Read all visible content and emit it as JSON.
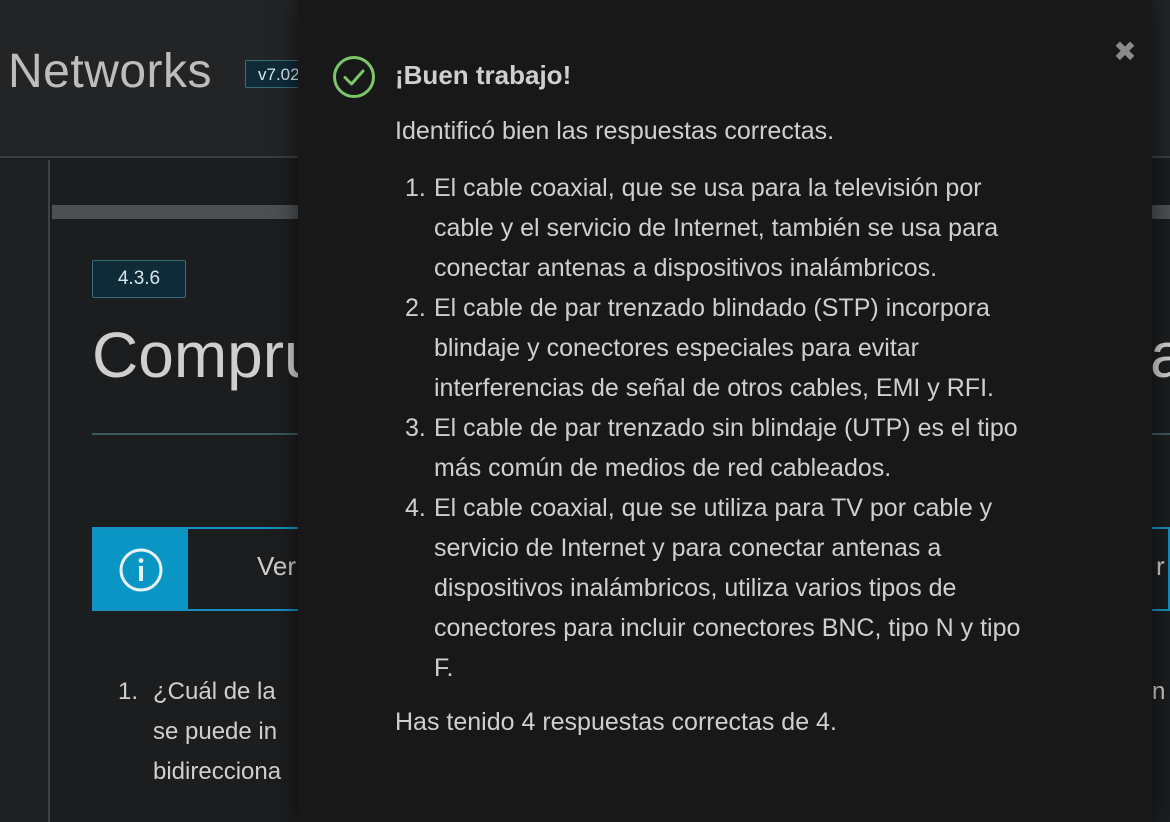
{
  "app": {
    "brand": "Networks",
    "version": "v7.02"
  },
  "page": {
    "section_number": "4.3.6",
    "heading_visible": "Compru",
    "heading_tail": "a",
    "info_bar_text": "Ver",
    "info_bar_tail": "r",
    "question": {
      "number": "1.",
      "lines": [
        "¿Cuál de la",
        "se puede in",
        "bidirecciona"
      ],
      "tail": "n"
    }
  },
  "modal": {
    "close_label": "✖",
    "title": "¡Buen trabajo!",
    "intro": "Identificó bien las respuestas correctas.",
    "items": [
      {
        "num": "1.",
        "lines": [
          "El cable coaxial, que se usa para la televisión por",
          "cable y el servicio de Internet, también se usa para",
          "conectar antenas a dispositivos inalámbricos."
        ]
      },
      {
        "num": "2.",
        "lines": [
          "El cable de par trenzado blindado (STP) incorpora",
          "blindaje y conectores especiales para evitar",
          "interferencias de señal de otros cables, EMI y RFI."
        ]
      },
      {
        "num": "3.",
        "lines": [
          "El cable de par trenzado sin blindaje (UTP) es el tipo",
          "más común de medios de red cableados."
        ]
      },
      {
        "num": "4.",
        "lines": [
          "El cable coaxial, que se utiliza para TV por cable y",
          "servicio de Internet y para conectar antenas a",
          "dispositivos inalámbricos, utiliza varios tipos de",
          "conectores para incluir conectores BNC, tipo N y tipo",
          "F."
        ]
      }
    ],
    "score": "Has tenido 4 respuestas correctas de 4."
  },
  "icons": {
    "close": "close-icon",
    "success": "check-circle-icon",
    "info": "info-icon"
  },
  "colors": {
    "success": "#7cc56a",
    "info": "#0a96c4",
    "badge_bg": "#0f2b38"
  }
}
